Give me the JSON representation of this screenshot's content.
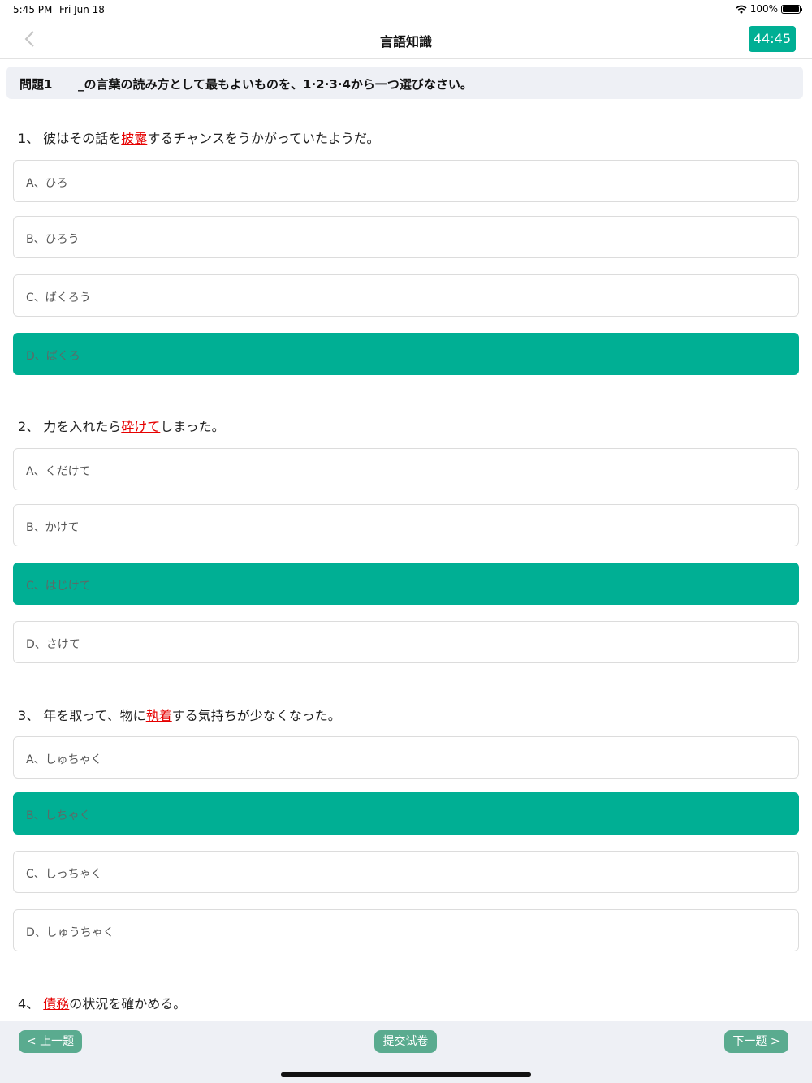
{
  "status_bar": {
    "time": "5:45 PM",
    "date": "Fri Jun 18",
    "battery": "100%"
  },
  "nav": {
    "title": "言語知識",
    "timer": "44:45"
  },
  "instruction": {
    "label": "問題1",
    "text": "_の言葉の読み方として最もよいものを、1·2·3·4から一つ選びなさい。"
  },
  "questions": [
    {
      "number": "1、",
      "before": "彼はその話を",
      "highlight": "披露",
      "after": "するチャンスをうかがっていたようだ。",
      "options": [
        "A、ひろ",
        "B、ひろう",
        "C、ばくろう",
        "D、ばくろ"
      ],
      "selected": 3
    },
    {
      "number": "2、",
      "before": "力を入れたら",
      "highlight": "砕けて",
      "after": "しまった。",
      "options": [
        "A、くだけて",
        "B、かけて",
        "C、はじけて",
        "D、さけて"
      ],
      "selected": 2
    },
    {
      "number": "3、",
      "before": "年を取って、物に",
      "highlight": "執着",
      "after": "する気持ちが少なくなった。",
      "options": [
        "A、しゅちゃく",
        "B、しちゃく",
        "C、しっちゃく",
        "D、しゅうちゃく"
      ],
      "selected": 1
    },
    {
      "number": "4、",
      "before": "",
      "highlight": "債務",
      "after": "の状況を確かめる。",
      "options": [],
      "selected": null
    }
  ],
  "bottom": {
    "prev": "< 上一题",
    "submit": "提交试卷",
    "next": "下一题 >"
  },
  "colors": {
    "accent": "#00af94",
    "highlight": "#e60000",
    "button": "#5aab8f"
  }
}
